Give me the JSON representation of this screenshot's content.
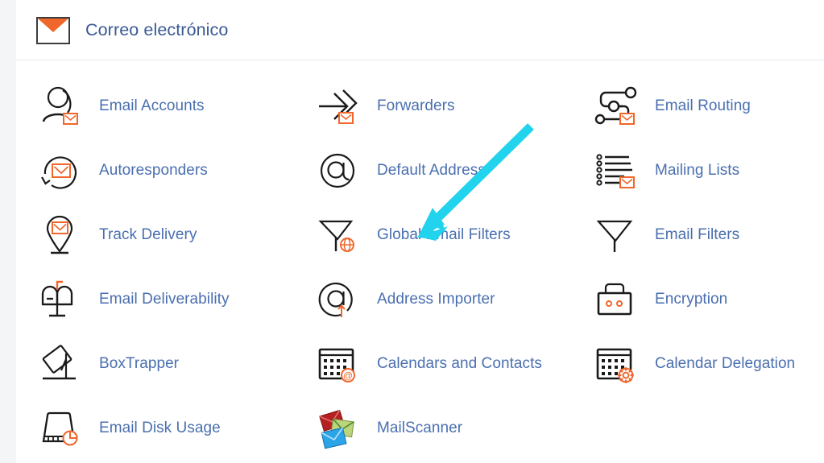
{
  "header": {
    "title": "Correo electrónico",
    "icon": "envelope-icon"
  },
  "colors": {
    "link_blue": "#4a6fb0",
    "title_blue": "#3b5a96",
    "accent_orange": "#f0662b",
    "icon_stroke": "#1a1a1a",
    "gutter_grey": "#f4f5f7",
    "divider": "#e4e8ee",
    "annotation_cyan": "#22d3ee"
  },
  "grid": {
    "items": [
      {
        "label": "Email Accounts",
        "icon": "user-envelope-icon"
      },
      {
        "label": "Forwarders",
        "icon": "arrow-forward-envelope-icon"
      },
      {
        "label": "Email Routing",
        "icon": "routing-nodes-envelope-icon"
      },
      {
        "label": "Autoresponders",
        "icon": "circular-arrow-envelope-icon"
      },
      {
        "label": "Default Address",
        "icon": "at-sign-circle-icon"
      },
      {
        "label": "Mailing Lists",
        "icon": "list-lines-envelope-icon"
      },
      {
        "label": "Track Delivery",
        "icon": "map-pin-envelope-icon"
      },
      {
        "label": "Global Email Filters",
        "icon": "funnel-globe-icon"
      },
      {
        "label": "Email Filters",
        "icon": "funnel-icon"
      },
      {
        "label": "Email Deliverability",
        "icon": "mailbox-flag-icon"
      },
      {
        "label": "Address Importer",
        "icon": "at-sign-upload-icon"
      },
      {
        "label": "Encryption",
        "icon": "padlock-icon"
      },
      {
        "label": "BoxTrapper",
        "icon": "box-trap-icon"
      },
      {
        "label": "Calendars and Contacts",
        "icon": "calendar-at-icon"
      },
      {
        "label": "Calendar Delegation",
        "icon": "calendar-gear-icon"
      },
      {
        "label": "Email Disk Usage",
        "icon": "disk-pie-icon"
      },
      {
        "label": "MailScanner",
        "icon": "stacked-envelopes-color-icon"
      }
    ]
  },
  "annotation": {
    "name": "pointer-arrow",
    "target_label": "Global Email Filters",
    "color": "#22d3ee"
  }
}
